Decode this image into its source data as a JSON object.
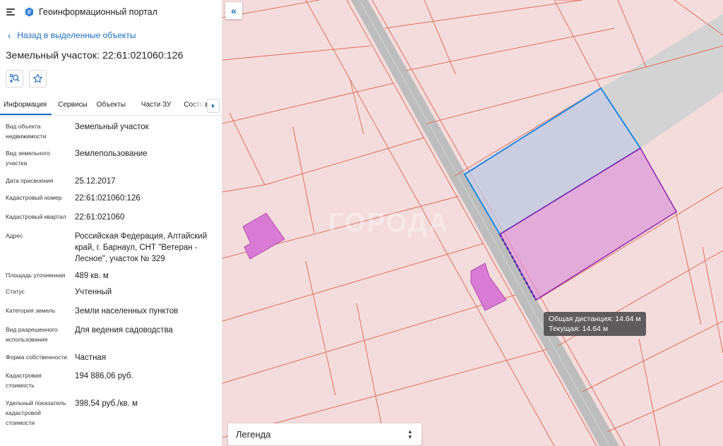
{
  "app": {
    "title": "Геоинформационный портал"
  },
  "nav": {
    "back_label": "Назад в выделенные объекты"
  },
  "object": {
    "title": "Земельный участок: 22:61:021060:126"
  },
  "tabs": [
    {
      "label": "Информация",
      "active": true
    },
    {
      "label": "Сервисы",
      "active": false
    },
    {
      "label": "Объекты",
      "active": false
    },
    {
      "label": "Части ЗУ",
      "active": false
    },
    {
      "label": "Состав",
      "active": false
    }
  ],
  "properties": [
    {
      "label": "Вид объекта недвижимости",
      "value": "Земельный участок"
    },
    {
      "label": "Вид земельного участка",
      "value": "Землепользование"
    },
    {
      "label": "Дата присвоения",
      "value": "25.12.2017"
    },
    {
      "label": "Кадастровый номер",
      "value": "22:61:021060:126"
    },
    {
      "label": "Кадастровый квартал",
      "value": "22:61:021060"
    },
    {
      "label": "Адрес",
      "value": "Российская Федерация, Алтайский край, г. Барнаул, СНТ \"Ветеран - Лесное\", участок № 329"
    },
    {
      "label": "Площадь уточненная",
      "value": "489 кв. м"
    },
    {
      "label": "Статус",
      "value": "Учтенный"
    },
    {
      "label": "Категория земель",
      "value": "Земли населенных пунктов"
    },
    {
      "label": "Вид разрешенного использования",
      "value": "Для ведения садоводства"
    },
    {
      "label": "Форма собственности",
      "value": "Частная"
    },
    {
      "label": "Кадастровая стоимость",
      "value": "194 886,06 руб."
    },
    {
      "label": "Удельный показатель кадастровой стоимости",
      "value": "398,54 руб./кв. м"
    }
  ],
  "map": {
    "tooltip_total": "Общая дистанция: 14.64 м",
    "tooltip_current": "Текущая: 14.64 м",
    "legend_label": "Легенда",
    "watermark": "ГОРОДА"
  },
  "colors": {
    "accent": "#1e6fc4",
    "map_bg": "#f4dcdc",
    "parcel_line": "#e0705f",
    "road": "#b8b8b8",
    "selection_blue": "#1e88e5",
    "selection_purple": "#8e24aa",
    "building": "#d97ad4"
  }
}
